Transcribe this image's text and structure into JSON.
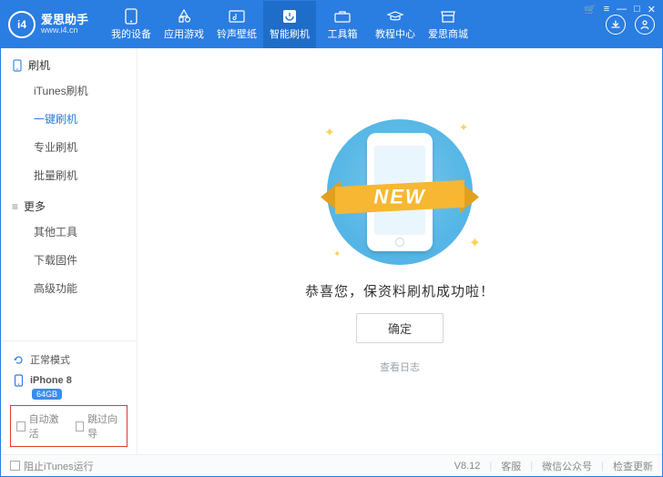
{
  "brand": {
    "name": "爱思助手",
    "url": "www.i4.cn",
    "logo_text": "i4"
  },
  "nav": {
    "items": [
      {
        "label": "我的设备"
      },
      {
        "label": "应用游戏"
      },
      {
        "label": "铃声壁纸"
      },
      {
        "label": "智能刷机"
      },
      {
        "label": "工具箱"
      },
      {
        "label": "教程中心"
      },
      {
        "label": "爱思商城"
      }
    ]
  },
  "sidebar": {
    "section1": {
      "title": "刷机",
      "items": [
        "iTunes刷机",
        "一键刷机",
        "专业刷机",
        "批量刷机"
      ]
    },
    "section2": {
      "title": "更多",
      "items": [
        "其他工具",
        "下载固件",
        "高级功能"
      ]
    },
    "mode": "正常模式",
    "device": {
      "name": "iPhone 8",
      "storage": "64GB"
    },
    "auto_activate": "自动激活",
    "skip_guide": "跳过向导"
  },
  "main": {
    "ribbon": "NEW",
    "success": "恭喜您，保资料刷机成功啦！",
    "ok": "确定",
    "view_log": "查看日志"
  },
  "footer": {
    "block_itunes": "阻止iTunes运行",
    "version": "V8.12",
    "support": "客服",
    "wechat": "微信公众号",
    "update": "检查更新"
  }
}
